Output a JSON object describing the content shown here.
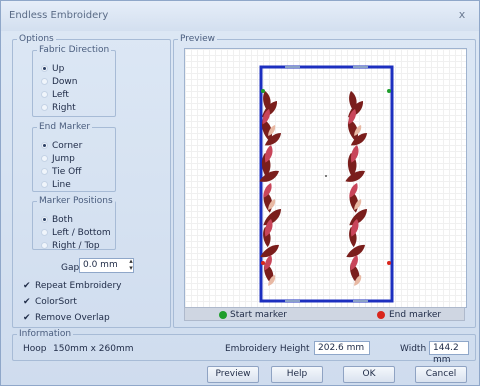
{
  "window": {
    "title": "Endless Embroidery",
    "close_glyph": "x"
  },
  "options": {
    "legend": "Options",
    "fabric_direction": {
      "legend": "Fabric Direction",
      "items": [
        "Up",
        "Down",
        "Left",
        "Right"
      ],
      "selected": "Up"
    },
    "end_marker": {
      "legend": "End Marker",
      "items": [
        "Corner",
        "Jump",
        "Tie Off",
        "Line"
      ],
      "selected": "Corner"
    },
    "marker_positions": {
      "legend": "Marker Positions",
      "items": [
        "Both",
        "Left / Bottom",
        "Right / Top"
      ],
      "selected": "Both"
    },
    "gap": {
      "label": "Gap",
      "value": "0.0 mm"
    },
    "checkboxes": [
      {
        "label": "Repeat Embroidery",
        "checked": true
      },
      {
        "label": "ColorSort",
        "checked": true
      },
      {
        "label": "Remove Overlap",
        "checked": true
      }
    ]
  },
  "preview": {
    "legend": "Preview",
    "start_marker_label": "Start marker",
    "end_marker_label": "End marker",
    "start_marker_color": "#1f9e2c",
    "end_marker_color": "#d9261c",
    "frame_color": "#1c2fbf"
  },
  "information": {
    "legend": "Information",
    "hoop_label": "Hoop",
    "hoop_value": "150mm x 260mm",
    "embroidery_height_label": "Embroidery Height",
    "embroidery_height_value": "202.6 mm",
    "width_label": "Width",
    "width_value": "144.2 mm"
  },
  "buttons": {
    "preview": "Preview",
    "help": "Help",
    "ok": "OK",
    "cancel": "Cancel"
  }
}
